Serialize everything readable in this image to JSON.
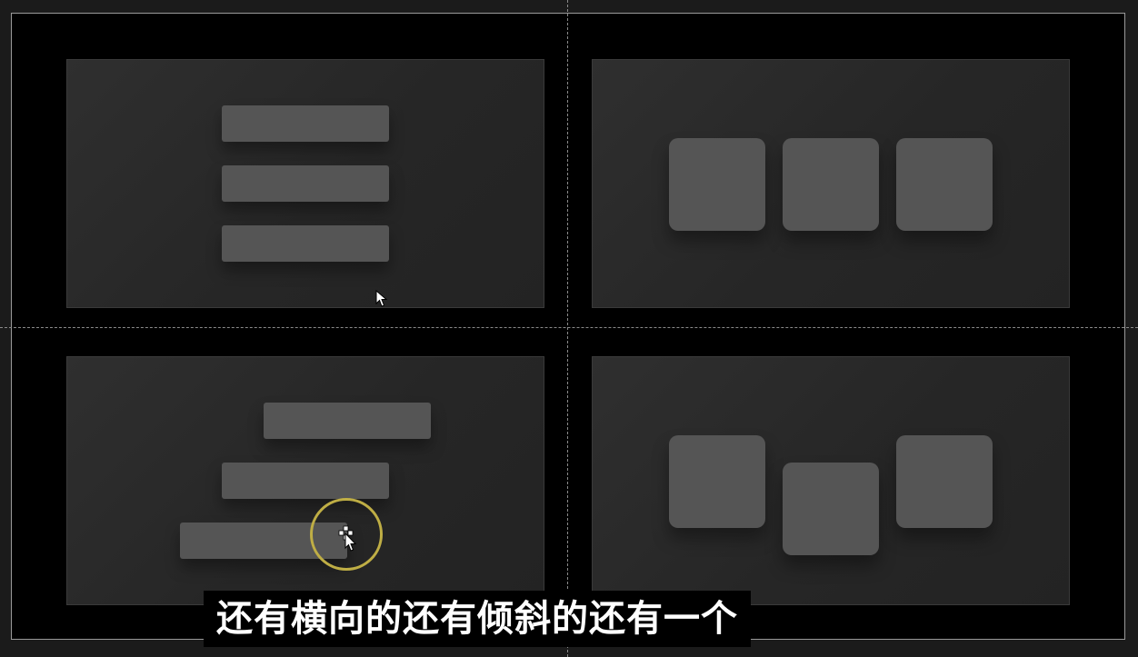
{
  "subtitle": {
    "text": "还有横向的还有倾斜的还有一个"
  },
  "layouts": [
    {
      "name": "vertical-stack",
      "shape": "bar",
      "count": 3
    },
    {
      "name": "horizontal-row",
      "shape": "square",
      "count": 3
    },
    {
      "name": "diagonal-stack",
      "shape": "bar",
      "count": 3
    },
    {
      "name": "staggered-row",
      "shape": "square",
      "count": 3
    }
  ],
  "colors": {
    "background": "#1b1b1b",
    "canvas": "#000000",
    "panel": "#2a2a2a",
    "shape": "#555555",
    "click_ring": "#bfae45",
    "subtitle_text": "#ffffff"
  },
  "icons": {
    "pointer": "arrow-cursor-icon",
    "move": "move-cursor-icon"
  }
}
